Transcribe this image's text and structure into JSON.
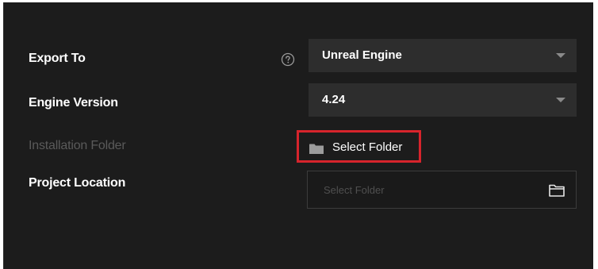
{
  "export_to": {
    "label": "Export To",
    "value": "Unreal Engine",
    "help_icon": "question-circle-icon"
  },
  "engine_version": {
    "label": "Engine Version",
    "value": "4.24"
  },
  "installation_folder": {
    "label": "Installation Folder",
    "button_label": "Select Folder",
    "button_icon": "folder-filled-icon",
    "highlight_color": "#d7242c"
  },
  "project_location": {
    "label": "Project Location",
    "placeholder": "Select Folder",
    "browse_icon": "folder-outline-icon"
  },
  "colors": {
    "background": "#1c1c1c",
    "control": "#2d2d2d",
    "text": "#ffffff",
    "disabled_text": "#5a5a5a"
  }
}
